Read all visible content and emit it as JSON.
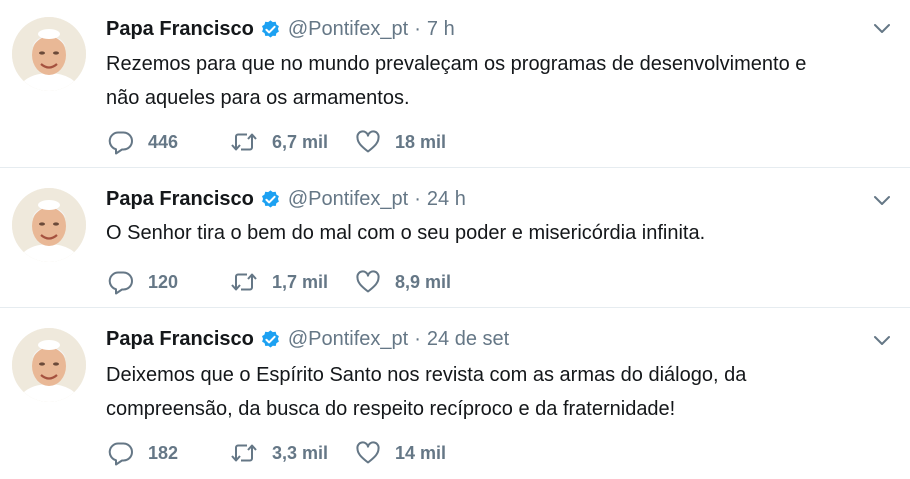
{
  "tweets": [
    {
      "author_name": "Papa Francisco",
      "handle": "@Pontifex_pt",
      "separator": "·",
      "time": "7 h",
      "text_lines": [
        "Rezemos para que no mundo prevaleçam os programas de desenvolvimento e",
        "não aqueles para os armamentos."
      ],
      "replies": "446",
      "retweets": "6,7 mil",
      "likes": "18 mil"
    },
    {
      "author_name": "Papa Francisco",
      "handle": "@Pontifex_pt",
      "separator": "·",
      "time": "24 h",
      "text_lines": [
        "O Senhor tira o bem do mal com o seu poder e misericórdia infinita."
      ],
      "replies": "120",
      "retweets": "1,7 mil",
      "likes": "8,9 mil"
    },
    {
      "author_name": "Papa Francisco",
      "handle": "@Pontifex_pt",
      "separator": "·",
      "time": "24 de set",
      "text_lines": [
        "Deixemos que o Espírito Santo nos revista com as armas do diálogo, da",
        "compreensão, da busca do respeito recíproco e da fraternidade!"
      ],
      "replies": "182",
      "retweets": "3,3 mil",
      "likes": "14 mil"
    }
  ],
  "icons": {
    "verified": "verified-badge-icon",
    "menu": "chevron-down-icon",
    "reply": "reply-icon",
    "retweet": "retweet-icon",
    "like": "heart-icon"
  },
  "colors": {
    "text": "#14171a",
    "secondary": "#657786",
    "verified": "#1da1f2",
    "divider": "#e6ecf0"
  }
}
